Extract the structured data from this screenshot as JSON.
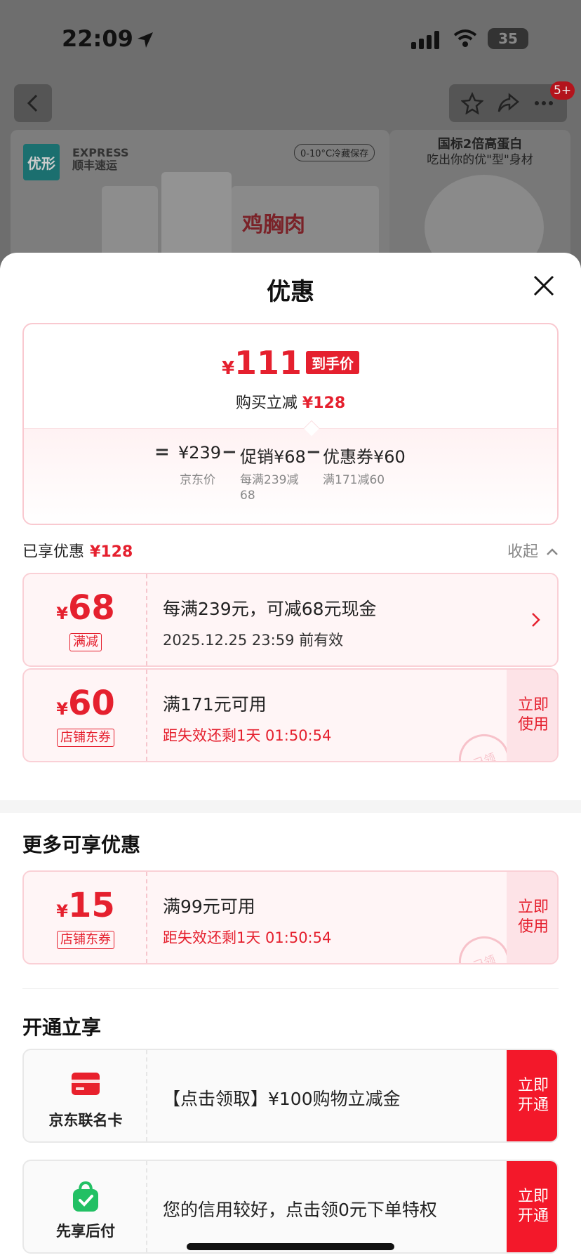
{
  "status_bar": {
    "time": "22:09",
    "battery": "35"
  },
  "top_nav": {
    "badge": "5+"
  },
  "banner": {
    "brand_logo": "优形",
    "courier_logo": "EXPRESS\n顺丰速运",
    "cold_chain_tag": "0-10°C冷藏保存",
    "product_text": "鸡胸肉",
    "promo_line1": "国标2倍高蛋白",
    "promo_line2": "吃出你的优\"型\"身材"
  },
  "sheet": {
    "title": "优惠",
    "summary": {
      "currency": "¥",
      "final_price": "111",
      "final_tag": "到手价",
      "reduce_label": "购买立减",
      "reduce_amount": "¥128",
      "equals": "=",
      "minus": "−",
      "jd_price": "¥239",
      "jd_price_label": "京东价",
      "promo": "促销¥68",
      "promo_label": "每满239减\n68",
      "coupon": "优惠券¥60",
      "coupon_label": "满171减60"
    },
    "enjoyed": {
      "label": "已享优惠",
      "amount": "¥128",
      "collapse": "收起"
    },
    "enjoyed_coupons": [
      {
        "currency": "¥",
        "amount": "68",
        "tag": "满减",
        "main": "每满239元，可减68元现金",
        "sub": "2025.12.25 23:59 前有效"
      },
      {
        "currency": "¥",
        "amount": "60",
        "tag": "店铺东券",
        "main": "满171元可用",
        "sub": "距失效还剩1天 01:50:54",
        "action": "立即\n使用",
        "stamp": "已领"
      }
    ],
    "more_title": "更多可享优惠",
    "more_coupons": [
      {
        "currency": "¥",
        "amount": "15",
        "tag": "店铺东券",
        "main": "满99元可用",
        "sub": "距失效还剩1天 01:50:54",
        "action": "立即\n使用",
        "stamp": "已领"
      }
    ],
    "open_title": "开通立享",
    "services": [
      {
        "name": "京东联名卡",
        "text": "【点击领取】¥100购物立减金",
        "action": "立即\n开通",
        "icon": "card-icon"
      },
      {
        "name": "先享后付",
        "text": "您的信用较好，点击领0元下单特权",
        "action": "立即\n开通",
        "icon": "shopping-bag-icon"
      }
    ]
  },
  "colors": {
    "accent": "#e5202e",
    "button_red": "#f3182a",
    "coupon_bg": "#fff5f6"
  }
}
